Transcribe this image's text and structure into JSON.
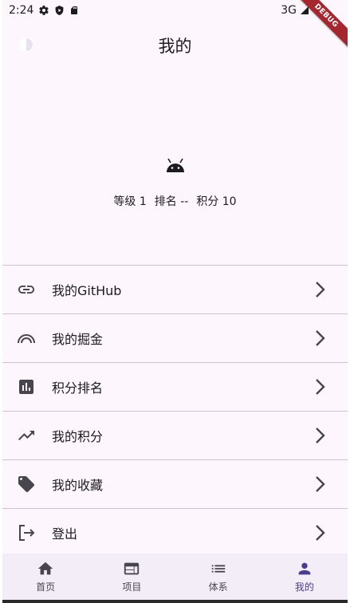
{
  "status_bar": {
    "time": "2:24",
    "network": "3G"
  },
  "debug_banner": "DEBUG",
  "app_bar": {
    "title": "我的"
  },
  "profile": {
    "level": "等级 1",
    "rank": "排名 --",
    "points": "积分 10"
  },
  "menu": [
    {
      "label": "我的GitHub",
      "icon": "link-icon"
    },
    {
      "label": "我的掘金",
      "icon": "rainbow-icon"
    },
    {
      "label": "积分排名",
      "icon": "bar-chart-icon"
    },
    {
      "label": "我的积分",
      "icon": "trending-up-icon"
    },
    {
      "label": "我的收藏",
      "icon": "tag-icon"
    },
    {
      "label": "登出",
      "icon": "logout-icon"
    }
  ],
  "bottom_nav": [
    {
      "label": "首页",
      "icon": "home-icon",
      "active": false
    },
    {
      "label": "项目",
      "icon": "web-icon",
      "active": false
    },
    {
      "label": "体系",
      "icon": "list-icon",
      "active": false
    },
    {
      "label": "我的",
      "icon": "person-icon",
      "active": true
    }
  ],
  "colors": {
    "background": "#fdf7fd",
    "nav_background": "#f3edf7",
    "active": "#4a3d8f",
    "divider": "#cac4cf",
    "debug_ribbon": "#a5262e"
  }
}
